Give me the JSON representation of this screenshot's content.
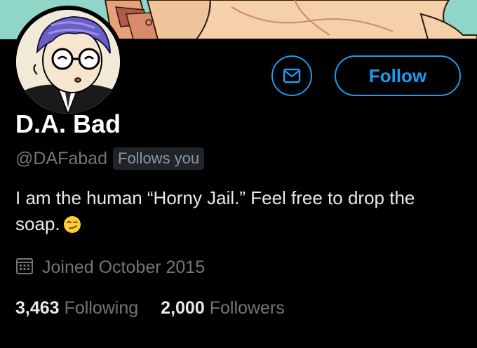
{
  "profile": {
    "display_name": "D.A. Bad",
    "handle": "@DAFabad",
    "follows_you_badge": "Follows you",
    "bio_text": "I am the human “Horny Jail.” Feel free to drop the soap.",
    "bio_emoji": "smirking-face-emoji",
    "joined": "Joined October 2015",
    "following_count": "3,463",
    "following_label": "Following",
    "followers_count": "2,000",
    "followers_label": "Followers"
  },
  "actions": {
    "follow_label": "Follow",
    "message_icon": "envelope-icon"
  },
  "icons": {
    "joined": "calendar-icon"
  },
  "colors": {
    "background": "#000000",
    "accent": "#1d9bf0",
    "secondary_text": "#71767b",
    "primary_text": "#e7e9ea",
    "badge_bg": "#202327"
  }
}
